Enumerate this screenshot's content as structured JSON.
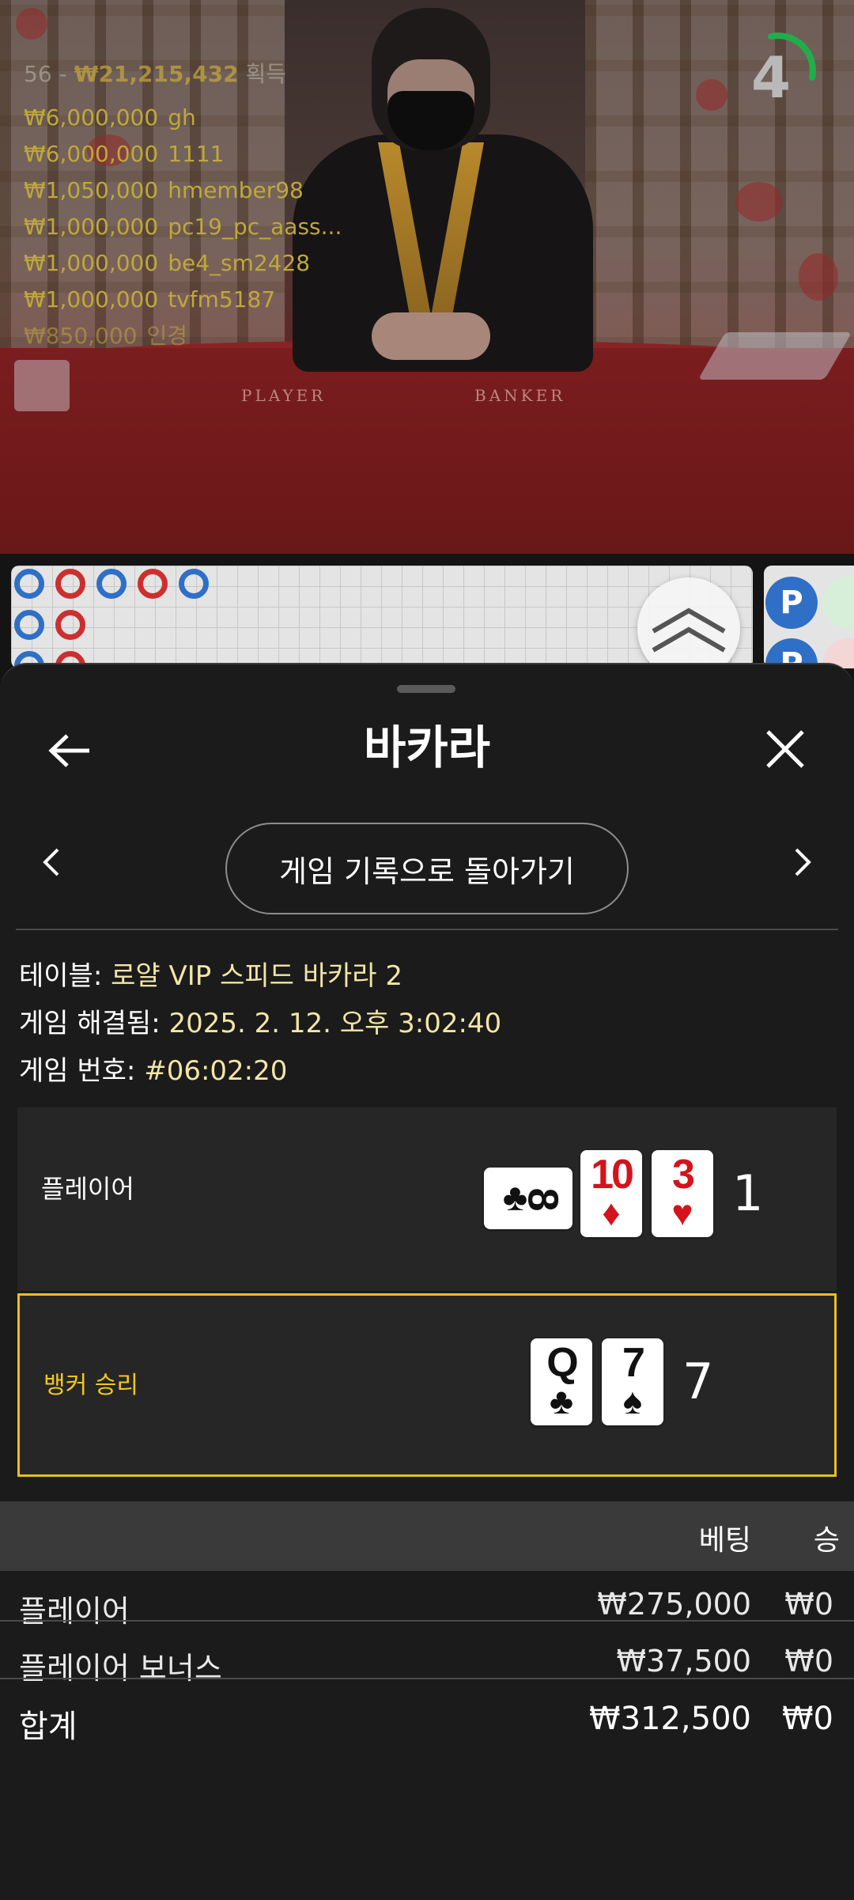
{
  "live_feed": {
    "winners_header": {
      "count": "56",
      "separator": "-",
      "total": "₩21,215,432",
      "suffix": "획득"
    },
    "winners": [
      {
        "amount": "₩6,000,000",
        "user": "gh"
      },
      {
        "amount": "₩6,000,000",
        "user": "1111"
      },
      {
        "amount": "₩1,050,000",
        "user": "hmember98"
      },
      {
        "amount": "₩1,000,000",
        "user": "pc19_pc_aass..."
      },
      {
        "amount": "₩1,000,000",
        "user": "be4_sm2428"
      },
      {
        "amount": "₩1,000,000",
        "user": "tvfm5187"
      },
      {
        "amount": "₩850,000",
        "user": "인경"
      }
    ],
    "countdown": "4",
    "table_labels": {
      "player": "PLAYER",
      "banker": "BANKER"
    },
    "stats_badges": [
      "P",
      "P"
    ]
  },
  "sheet": {
    "title": "바카라",
    "back_to_history": "게임 기록으로 돌아가기",
    "table": {
      "label": "테이블:",
      "value": "로얄 VIP 스피드 바카라 2"
    },
    "resolved": {
      "label": "게임 해결됨:",
      "value": "2025. 2. 12. 오후 3:02:40"
    },
    "game_no": {
      "label": "게임 번호:",
      "value": "#06:02:20"
    },
    "player_hand": {
      "label": "플레이어",
      "cards": [
        {
          "rank": "8",
          "suit": "♣",
          "color": "black",
          "orientation": "sideways"
        },
        {
          "rank": "10",
          "suit": "♦",
          "color": "red"
        },
        {
          "rank": "3",
          "suit": "♥",
          "color": "red"
        }
      ],
      "score": "1"
    },
    "banker_hand": {
      "label": "뱅커 승리",
      "cards": [
        {
          "rank": "Q",
          "suit": "♣",
          "color": "black"
        },
        {
          "rank": "7",
          "suit": "♠",
          "color": "black"
        }
      ],
      "score": "7"
    },
    "bets": {
      "col_bet": "베팅",
      "col_win": "승",
      "rows": [
        {
          "name": "플레이어",
          "bet": "₩275,000",
          "win": "₩0"
        },
        {
          "name": "플레이어 보너스",
          "bet": "₩37,500",
          "win": "₩0"
        }
      ],
      "total": {
        "name": "합계",
        "bet": "₩312,500",
        "win": "₩0"
      }
    }
  },
  "colors": {
    "sheet_bg": "#1b1b1b",
    "highlight": "#f3e5a6",
    "winner_border": "#e8c020",
    "timer_green": "#1fae4a",
    "player_blue": "#2f6fc6",
    "banker_red": "#cc2f2f"
  }
}
